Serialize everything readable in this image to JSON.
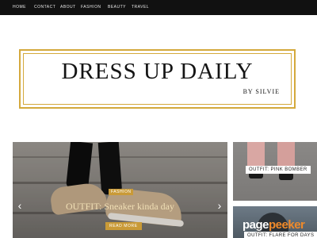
{
  "nav": {
    "items": [
      "HOME",
      "CONTACT",
      "ABOUT",
      "FASHION",
      "BEAUTY",
      "TRAVEL"
    ]
  },
  "header": {
    "title": "DRESS UP DAILY",
    "subtitle": "BY SILVIE"
  },
  "slider": {
    "category": "FASHION",
    "title": "OUTFIT: Sneaker kinda day",
    "button": "READ MORE",
    "prev_icon": "chevron-left-icon",
    "next_icon": "chevron-right-icon"
  },
  "side_posts": [
    {
      "title": "OUTFIT: PINK BOMBER"
    },
    {
      "title": "OUTFIT: FLARE FOR DAYS"
    }
  ],
  "watermark": {
    "part1": "page",
    "part2": "peeker"
  },
  "colors": {
    "nav_bg": "#111111",
    "accent_gold": "#c99a37",
    "logo_border": "#d4a93c",
    "watermark_orange": "#f08a2a"
  }
}
